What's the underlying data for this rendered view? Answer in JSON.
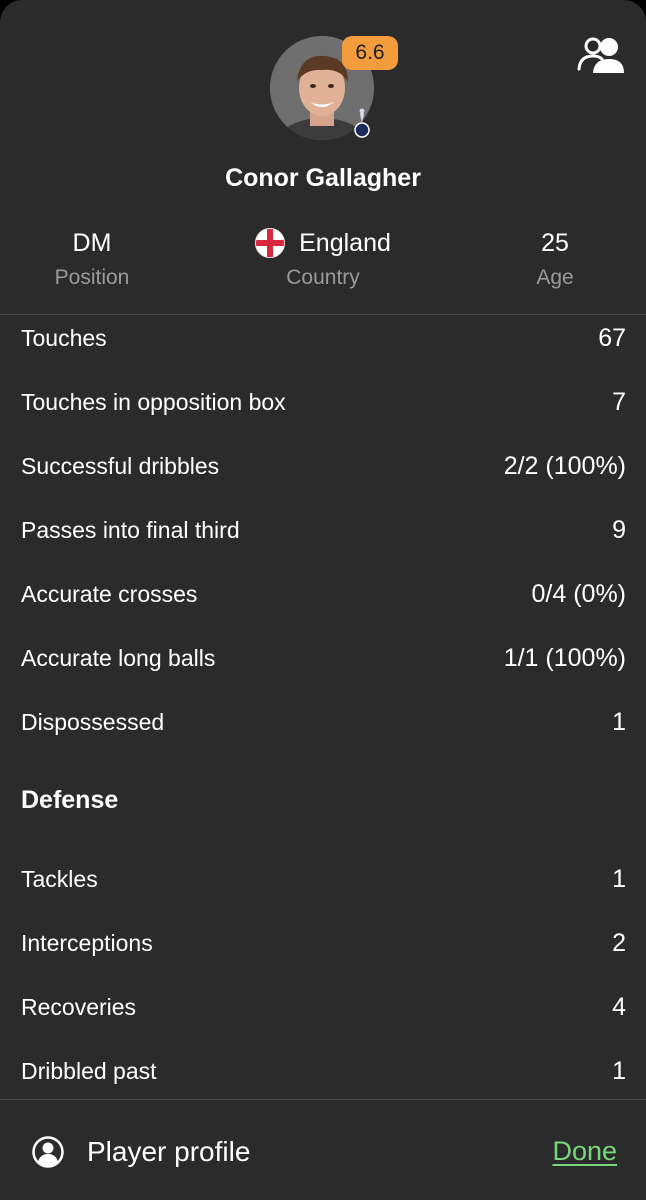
{
  "player": {
    "name": "Conor Gallagher",
    "rating": "6.6",
    "rating_color": "#f39c3c"
  },
  "info": {
    "position_value": "DM",
    "position_label": "Position",
    "country_value": "England",
    "country_label": "Country",
    "age_value": "25",
    "age_label": "Age"
  },
  "stats": [
    {
      "label": "Touches",
      "value": "67"
    },
    {
      "label": "Touches in opposition box",
      "value": "7"
    },
    {
      "label": "Successful dribbles",
      "value": "2/2 (100%)"
    },
    {
      "label": "Passes into final third",
      "value": "9"
    },
    {
      "label": "Accurate crosses",
      "value": "0/4 (0%)"
    },
    {
      "label": "Accurate long balls",
      "value": "1/1 (100%)"
    },
    {
      "label": "Dispossessed",
      "value": "1"
    }
  ],
  "defense": {
    "title": "Defense",
    "stats": [
      {
        "label": "Tackles",
        "value": "1"
      },
      {
        "label": "Interceptions",
        "value": "2"
      },
      {
        "label": "Recoveries",
        "value": "4"
      },
      {
        "label": "Dribbled past",
        "value": "1"
      }
    ]
  },
  "footer": {
    "profile_label": "Player profile",
    "done_label": "Done",
    "done_color": "#77d67b"
  },
  "icons": {
    "people": "people-icon",
    "club": "club-crest-icon",
    "flag": "england-flag-icon",
    "profile": "player-profile-icon"
  }
}
